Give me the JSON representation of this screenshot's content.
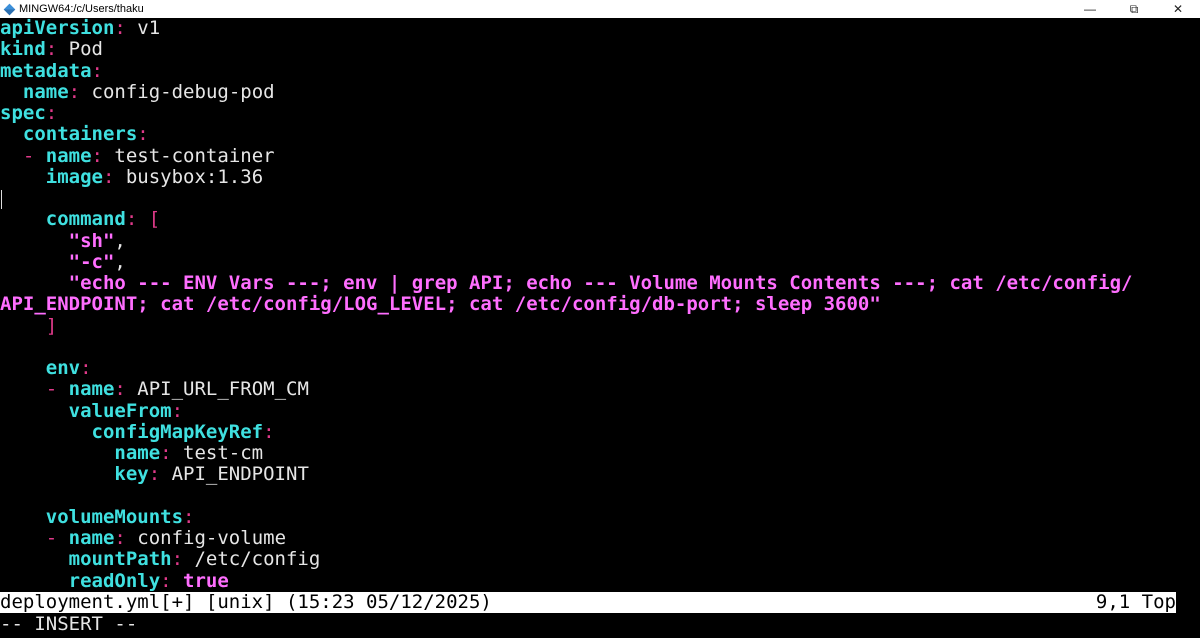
{
  "window": {
    "title": "MINGW64:/c/Users/thaku",
    "controls": {
      "minimize": "—",
      "maximize": "⧉",
      "close": "✕"
    }
  },
  "editor": {
    "lines": [
      [
        [
          "k",
          "apiVersion"
        ],
        [
          "p",
          ":"
        ],
        [
          "v",
          " v1"
        ]
      ],
      [
        [
          "k",
          "kind"
        ],
        [
          "p",
          ":"
        ],
        [
          "v",
          " Pod"
        ]
      ],
      [
        [
          "k",
          "metadata"
        ],
        [
          "p",
          ":"
        ]
      ],
      [
        [
          "v",
          "  "
        ],
        [
          "k",
          "name"
        ],
        [
          "p",
          ":"
        ],
        [
          "v",
          " config-debug-pod"
        ]
      ],
      [
        [
          "k",
          "spec"
        ],
        [
          "p",
          ":"
        ]
      ],
      [
        [
          "v",
          "  "
        ],
        [
          "k",
          "containers"
        ],
        [
          "p",
          ":"
        ]
      ],
      [
        [
          "p",
          "  - "
        ],
        [
          "k",
          "name"
        ],
        [
          "p",
          ":"
        ],
        [
          "v",
          " test-container"
        ]
      ],
      [
        [
          "v",
          "    "
        ],
        [
          "k",
          "image"
        ],
        [
          "p",
          ":"
        ],
        [
          "v",
          " busybox:1.36"
        ]
      ],
      [],
      [
        [
          "v",
          "    "
        ],
        [
          "k",
          "command"
        ],
        [
          "p",
          ": ["
        ]
      ],
      [
        [
          "v",
          "      "
        ],
        [
          "s",
          "\"sh\""
        ],
        [
          "v",
          ","
        ]
      ],
      [
        [
          "v",
          "      "
        ],
        [
          "s",
          "\"-c\""
        ],
        [
          "v",
          ","
        ]
      ],
      [
        [
          "v",
          "      "
        ],
        [
          "s",
          "\"echo --- ENV Vars ---; env | grep API; echo --- Volume Mounts Contents ---; cat /etc/config/"
        ]
      ],
      [
        [
          "s",
          "API_ENDPOINT; cat /etc/config/LOG_LEVEL; cat /etc/config/db-port; sleep 3600\""
        ]
      ],
      [
        [
          "v",
          "    "
        ],
        [
          "p",
          "]"
        ]
      ],
      [],
      [
        [
          "v",
          "    "
        ],
        [
          "k",
          "env"
        ],
        [
          "p",
          ":"
        ]
      ],
      [
        [
          "p",
          "    - "
        ],
        [
          "k",
          "name"
        ],
        [
          "p",
          ":"
        ],
        [
          "v",
          " API_URL_FROM_CM"
        ]
      ],
      [
        [
          "v",
          "      "
        ],
        [
          "k",
          "valueFrom"
        ],
        [
          "p",
          ":"
        ]
      ],
      [
        [
          "v",
          "        "
        ],
        [
          "k",
          "configMapKeyRef"
        ],
        [
          "p",
          ":"
        ]
      ],
      [
        [
          "v",
          "          "
        ],
        [
          "k",
          "name"
        ],
        [
          "p",
          ":"
        ],
        [
          "v",
          " test-cm"
        ]
      ],
      [
        [
          "v",
          "          "
        ],
        [
          "k",
          "key"
        ],
        [
          "p",
          ":"
        ],
        [
          "v",
          " API_ENDPOINT"
        ]
      ],
      [],
      [
        [
          "v",
          "    "
        ],
        [
          "k",
          "volumeMounts"
        ],
        [
          "p",
          ":"
        ]
      ],
      [
        [
          "p",
          "    - "
        ],
        [
          "k",
          "name"
        ],
        [
          "p",
          ":"
        ],
        [
          "v",
          " config-volume"
        ]
      ],
      [
        [
          "v",
          "      "
        ],
        [
          "k",
          "mountPath"
        ],
        [
          "p",
          ":"
        ],
        [
          "v",
          " /etc/config"
        ]
      ],
      [
        [
          "v",
          "      "
        ],
        [
          "k",
          "readOnly"
        ],
        [
          "p",
          ":"
        ],
        [
          "b",
          " true"
        ]
      ]
    ]
  },
  "status": {
    "left": "deployment.yml[+] [unix] (15:23 05/12/2025)",
    "right": "9,1 Top"
  },
  "mode": "-- INSERT --"
}
